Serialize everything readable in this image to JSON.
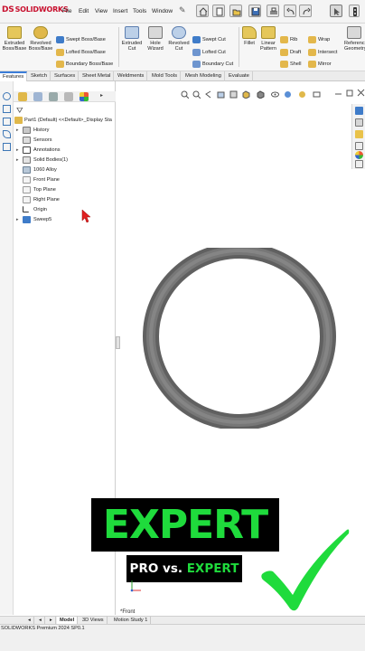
{
  "app": {
    "logo_text": "SOLIDWORKS",
    "logo_mark": "DS"
  },
  "menubar": {
    "items": [
      "File",
      "Edit",
      "View",
      "Insert",
      "Tools",
      "Window"
    ]
  },
  "ribbon": {
    "extruded_boss": "Extruded Boss/Base",
    "revolved_boss": "Revolved Boss/Base",
    "swept_boss": "Swept Boss/Base",
    "lofted_boss": "Lofted Boss/Base",
    "boundary_boss": "Boundary Boss/Base",
    "extruded_cut": "Extruded Cut",
    "hole_wizard": "Hole Wizard",
    "revolved_cut": "Revolved Cut",
    "swept_cut": "Swept Cut",
    "lofted_cut": "Lofted Cut",
    "boundary_cut": "Boundary Cut",
    "fillet": "Fillet",
    "linear_pattern": "Linear Pattern",
    "rib": "Rib",
    "draft": "Draft",
    "shell": "Shell",
    "wrap": "Wrap",
    "intersect": "Intersect",
    "mirror": "Mirror",
    "reference_geometry": "Reference Geometry"
  },
  "tabs": [
    "Features",
    "Sketch",
    "Surfaces",
    "Sheet Metal",
    "Weldments",
    "Mold Tools",
    "Mesh Modeling",
    "Evaluate"
  ],
  "tree": {
    "root": "Part1 (Default) <<Default>_Display Sta",
    "items": [
      "History",
      "Sensors",
      "Annotations",
      "Solid Bodies(1)",
      "1060 Alloy",
      "Front Plane",
      "Top Plane",
      "Right Plane",
      "Origin",
      "Sweep5"
    ]
  },
  "overlay": {
    "title": "EXPERT",
    "sub_left": "PRO vs.",
    "sub_right": "EXPERT"
  },
  "view": {
    "label": "*Front"
  },
  "bottom_tabs": [
    "Model",
    "3D Views",
    "Motion Study 1"
  ],
  "status": {
    "text": "SOLIDWORKS Premium 2024 SP0.1"
  },
  "colors": {
    "accent_green": "#1fdb3c",
    "brand_red": "#c8102e",
    "ring_gray": "#6e6e6e"
  }
}
